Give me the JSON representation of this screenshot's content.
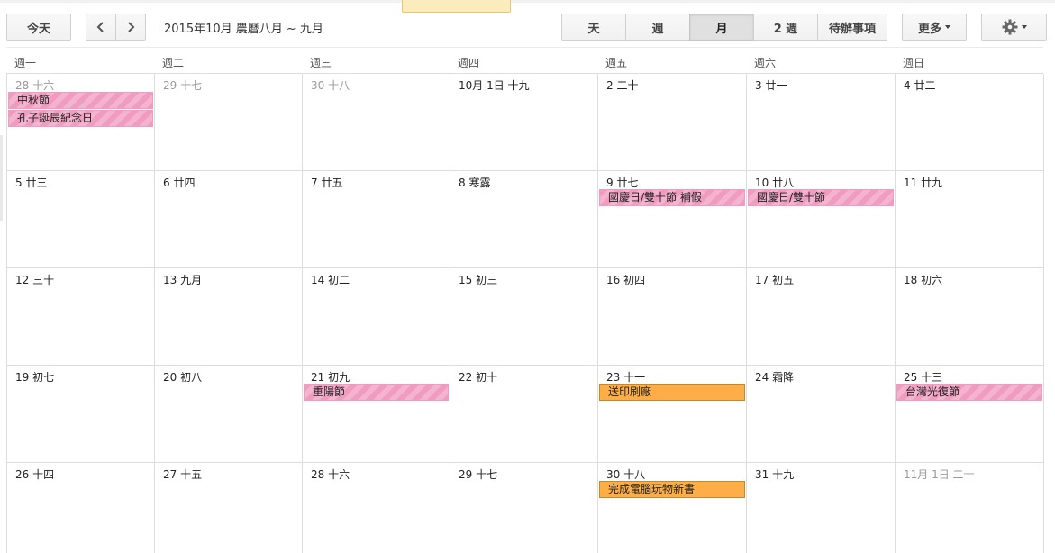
{
  "toolbar": {
    "today_label": "今天",
    "prev_icon": "chevron-left-icon",
    "next_icon": "chevron-right-icon",
    "date_range": "2015年10月 農曆八月 ~ 九月",
    "views": [
      "天",
      "週",
      "月",
      "2 週",
      "待辦事項"
    ],
    "selected_view": "月",
    "more_label": "更多",
    "settings_icon": "gear-icon"
  },
  "weekdays": [
    "週一",
    "週二",
    "週三",
    "週四",
    "週五",
    "週六",
    "週日"
  ],
  "weeks": [
    [
      {
        "label": "28 十六",
        "other": true,
        "events": [
          {
            "title": "中秋節",
            "type": "holiday"
          },
          {
            "title": "孔子誕辰紀念日",
            "type": "holiday"
          }
        ]
      },
      {
        "label": "29 十七",
        "other": true,
        "events": []
      },
      {
        "label": "30 十八",
        "other": true,
        "events": []
      },
      {
        "label": "10月 1日 十九",
        "other": false,
        "events": []
      },
      {
        "label": "2 二十",
        "other": false,
        "events": []
      },
      {
        "label": "3 廿一",
        "other": false,
        "events": []
      },
      {
        "label": "4 廿二",
        "other": false,
        "events": []
      }
    ],
    [
      {
        "label": "5 廿三",
        "other": false,
        "events": []
      },
      {
        "label": "6 廿四",
        "other": false,
        "events": []
      },
      {
        "label": "7 廿五",
        "other": false,
        "events": []
      },
      {
        "label": "8 寒露",
        "other": false,
        "events": []
      },
      {
        "label": "9 廿七",
        "other": false,
        "events": [
          {
            "title": "國慶日/雙十節 補假",
            "type": "holiday"
          }
        ]
      },
      {
        "label": "10 廿八",
        "other": false,
        "events": [
          {
            "title": "國慶日/雙十節",
            "type": "holiday"
          }
        ]
      },
      {
        "label": "11 廿九",
        "other": false,
        "events": []
      }
    ],
    [
      {
        "label": "12 三十",
        "other": false,
        "events": []
      },
      {
        "label": "13 九月",
        "other": false,
        "events": []
      },
      {
        "label": "14 初二",
        "other": false,
        "events": []
      },
      {
        "label": "15 初三",
        "other": false,
        "events": []
      },
      {
        "label": "16 初四",
        "other": false,
        "events": []
      },
      {
        "label": "17 初五",
        "other": false,
        "events": []
      },
      {
        "label": "18 初六",
        "other": false,
        "events": []
      }
    ],
    [
      {
        "label": "19 初七",
        "other": false,
        "events": []
      },
      {
        "label": "20 初八",
        "other": false,
        "events": []
      },
      {
        "label": "21 初九",
        "other": false,
        "events": [
          {
            "title": "重陽節",
            "type": "holiday"
          }
        ]
      },
      {
        "label": "22 初十",
        "other": false,
        "events": []
      },
      {
        "label": "23 十一",
        "other": false,
        "events": [
          {
            "title": "送印刷廠",
            "type": "task"
          }
        ]
      },
      {
        "label": "24 霜降",
        "other": false,
        "events": []
      },
      {
        "label": "25 十三",
        "other": false,
        "events": [
          {
            "title": "台灣光復節",
            "type": "holiday"
          }
        ]
      }
    ],
    [
      {
        "label": "26 十四",
        "other": false,
        "events": []
      },
      {
        "label": "27 十五",
        "other": false,
        "events": []
      },
      {
        "label": "28 十六",
        "other": false,
        "events": []
      },
      {
        "label": "29 十七",
        "other": false,
        "events": []
      },
      {
        "label": "30 十八",
        "other": false,
        "events": [
          {
            "title": "完成電腦玩物新書",
            "type": "task"
          }
        ]
      },
      {
        "label": "31 十九",
        "other": false,
        "events": []
      },
      {
        "label": "11月 1日 二十",
        "other": true,
        "events": []
      }
    ]
  ],
  "colors": {
    "holiday": "#f09cc0",
    "task": "#ffad46",
    "grid_line": "#dddddd"
  }
}
